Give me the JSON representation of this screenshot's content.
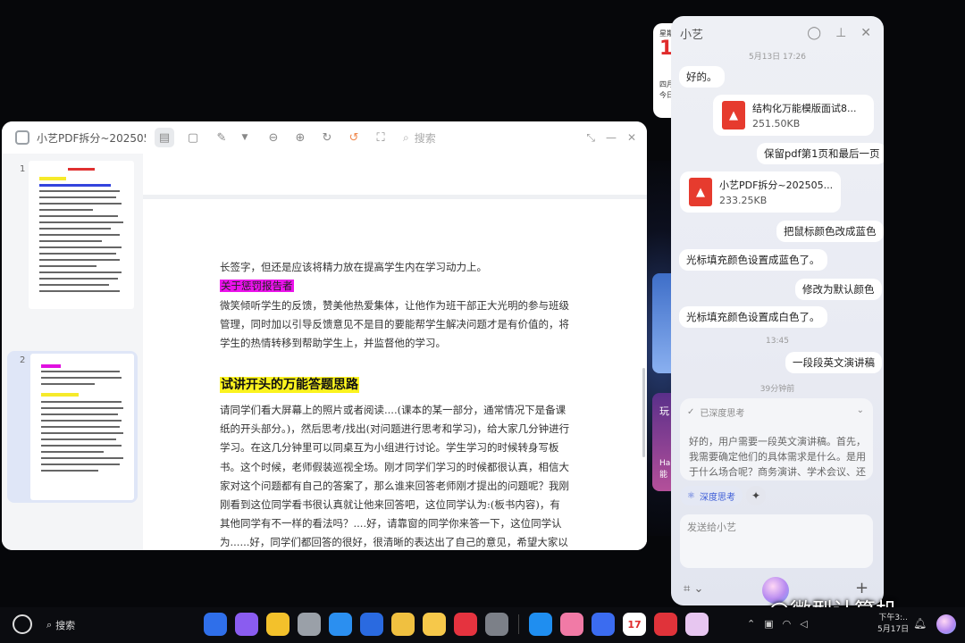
{
  "calendar_widget": {
    "weekday": "星期",
    "day": "1",
    "line1": "四月",
    "line2": "今日"
  },
  "desktop_card": {
    "line1": "玩",
    "line2": "Ha 能"
  },
  "pdf_window": {
    "title": "小艺PDF拆分~2025051...",
    "search_placeholder": "搜索",
    "thumbs": [
      {
        "num": "1"
      },
      {
        "num": "2"
      }
    ],
    "doc": {
      "p0": "长签字，但还是应该将精力放在提高学生内在学习动力上。",
      "h1": "关于惩罚报告者",
      "p1": "微笑倾听学生的反馈，赞美他热爱集体，让他作为班干部正大光明的参与班级管理，同时加以引导反馈意见不是目的要能帮学生解决问题才是有价值的，将学生的热情转移到帮助学生上，并监督他的学习。",
      "h2": "试讲开头的万能答题思路",
      "p2": "请同学们看大屏幕上的照片或者阅读....(课本的某一部分，通常情况下是备课纸的开头部分。)，然后思考/找出(对问题进行思考和学习)，给大家几分钟进行学习。在这几分钟里可以同桌互为小组进行讨论。学生学习的时候转身写板书。这个时候，老师假装巡视全场。刚才同学们学习的时候都很认真，相信大家对这个问题都有自己的答案了，那么谁来回答老师刚才提出的问题呢？我刚刚看到这位同学看书很认真就让他来回答吧，这位同学认为:(板书内容)，有其他同学有不一样的看法吗？....好，请靠窗的同学你来答一下，这位同学认为......好，同学们都回答的很好，很清晰的表达出了自己的意见，希望大家以后都可以这样"
    }
  },
  "assistant": {
    "title": "小艺",
    "ts1": "5月13日 17:26",
    "m1": "好的。",
    "file1": {
      "name": "结构化万能模版面试8...",
      "size": "251.50KB"
    },
    "m2": "保留pdf第1页和最后一页",
    "file2": {
      "name": "小艺PDF拆分~202505...",
      "size": "233.25KB"
    },
    "m3": "把鼠标颜色改成蓝色",
    "m4": "光标填充颜色设置成蓝色了。",
    "m5": "修改为默认颜色",
    "m6": "光标填充颜色设置成白色了。",
    "ts2": "13:45",
    "m7": "一段段英文演讲稿",
    "ts3": "39分钟前",
    "think_label": "已深度思考",
    "think_body": "好的，用户需要一段英文演讲稿。首先，我需要确定他们的具体需求是什么。是用于什么场合呢？商务演讲、学术会议、还",
    "mode_label": "深度思考",
    "input_placeholder": "发送给小艺"
  },
  "taskbar": {
    "search_label": "搜索",
    "calendar_day": "17",
    "clock_time": "下午3:..",
    "clock_date": "5月17日",
    "apps": [
      {
        "name": "grid",
        "color": "#2f6fea"
      },
      {
        "name": "window",
        "color": "#8a5cf0"
      },
      {
        "name": "notes",
        "color": "#f3c12b"
      },
      {
        "name": "trash",
        "color": "#9aa0a8"
      },
      {
        "name": "browser",
        "color": "#2b8ff0"
      },
      {
        "name": "mail",
        "color": "#2a6ae0"
      },
      {
        "name": "photos",
        "color": "#f0c040"
      },
      {
        "name": "memo",
        "color": "#f6c84a"
      },
      {
        "name": "app-gallery",
        "color": "#e5333f"
      },
      {
        "name": "settings",
        "color": "#7c8088"
      }
    ],
    "apps2": [
      {
        "name": "files",
        "color": "#1f8ef0"
      },
      {
        "name": "bilibili",
        "color": "#f17aa6"
      },
      {
        "name": "music",
        "color": "#3b6cf0"
      },
      {
        "name": "calendar",
        "color": "#ffffff"
      },
      {
        "name": "wps",
        "color": "#e0333a"
      },
      {
        "name": "gallery2",
        "color": "#e7c6f0"
      }
    ]
  },
  "watermark": "@微型计算机"
}
